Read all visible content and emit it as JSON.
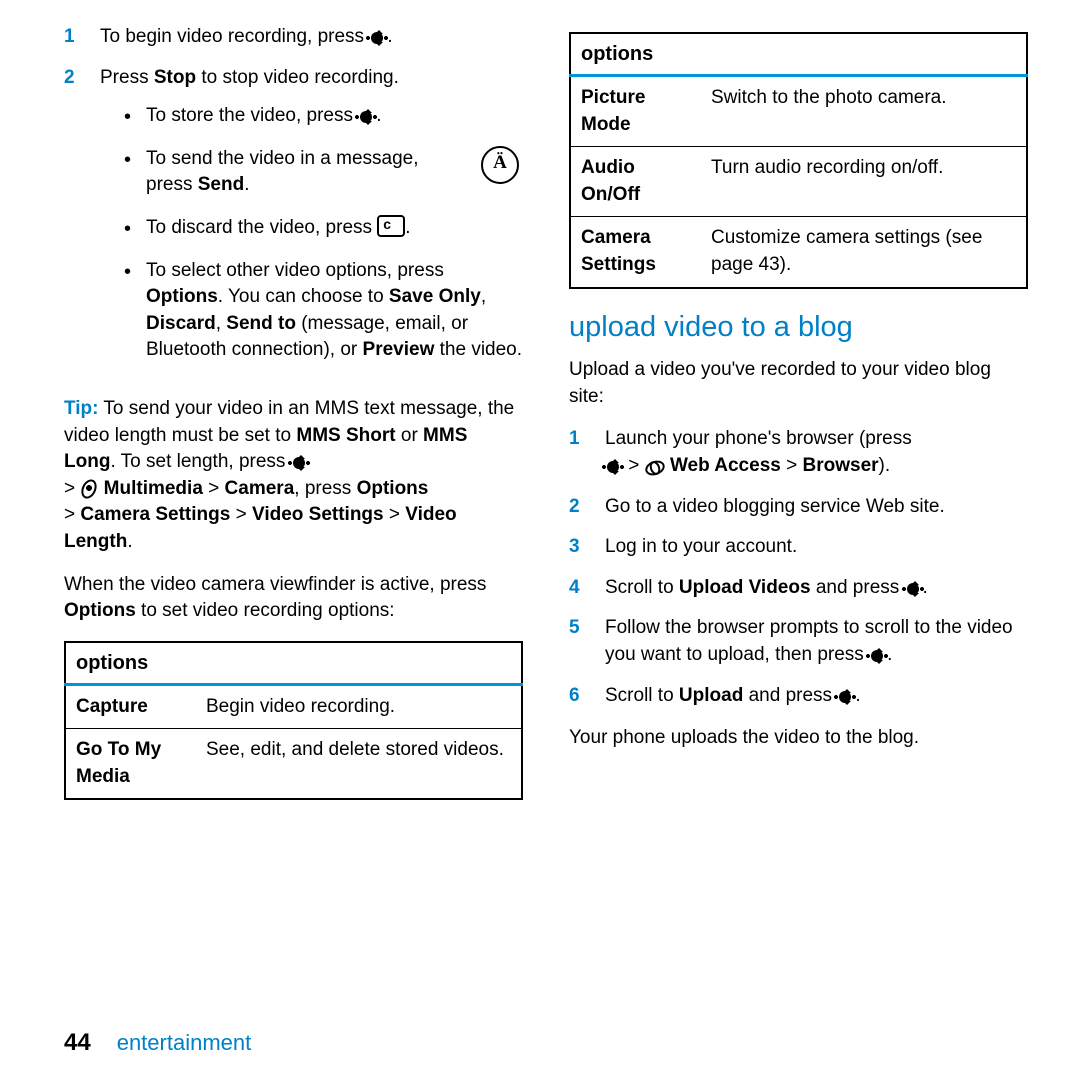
{
  "left": {
    "steps": [
      {
        "n": "1",
        "pre": "To begin video recording, press ",
        "post": "."
      },
      {
        "n": "2",
        "pre": "Press ",
        "b1": "Stop",
        "post": " to stop video recording.",
        "subs": [
          {
            "pre": "To store the video, press ",
            "icon": "center",
            "post": "."
          },
          {
            "pre": "To send the video in a message, press ",
            "b": "Send",
            "post": ".",
            "float": "antenna"
          },
          {
            "pre": "To discard the video, press ",
            "icon": "clear",
            "post": "."
          },
          {
            "pre": "To select other video options, press ",
            "b": "Options",
            "post2": ". You can choose to ",
            "b2": "Save Only",
            "c1": ", ",
            "b3": "Discard",
            "c2": ", ",
            "b4": "Send to",
            "post3": " (message, email, or Bluetooth connection), or ",
            "b5": "Preview",
            "post4": " the video."
          }
        ]
      }
    ],
    "tip": {
      "label": "Tip:",
      "t1": " To send your video in an MMS text message, the video length must be set to ",
      "b1": "MMS Short",
      "t2": " or ",
      "b2": "MMS Long",
      "t3": ". To set length, press ",
      "line2a": " > ",
      "b3": "Multimedia",
      "t4": " > ",
      "b4": "Camera",
      "t5": ", press ",
      "b5": "Options",
      "line3a": " > ",
      "b6": "Camera Settings",
      "t6": " > ",
      "b7": "Video Settings",
      "t7": " > ",
      "b8": "Video Length",
      "t8": "."
    },
    "p1a": "When the video camera viewfinder is active, press ",
    "p1b": "Options",
    "p1c": " to set video recording options:",
    "tableHeader": "options",
    "rows": [
      {
        "k": "Capture",
        "v": "Begin video recording."
      },
      {
        "k": "Go To My Media",
        "v": "See, edit, and delete stored videos."
      }
    ]
  },
  "right": {
    "tableHeader": "options",
    "rows": [
      {
        "k": "Picture Mode",
        "v": "Switch to the photo camera."
      },
      {
        "k": "Audio On/Off",
        "v": "Turn audio recording on/off."
      },
      {
        "k": "Camera Settings",
        "v": "Customize camera settings (see page 43)."
      }
    ],
    "heading": "upload video to a blog",
    "intro": "Upload a video you've recorded to your video blog site:",
    "steps": [
      {
        "n": "1",
        "t": "Launch your phone's browser (press",
        "line2": " > ",
        "b1": "Web Access",
        "t2": " > ",
        "b2": "Browser",
        "t3": ")."
      },
      {
        "n": "2",
        "t": "Go to a video blogging service Web site."
      },
      {
        "n": "3",
        "t": "Log in to your account."
      },
      {
        "n": "4",
        "t1": "Scroll to ",
        "b": "Upload Videos",
        "t2": " and press ",
        "post": "."
      },
      {
        "n": "5",
        "t1": "Follow the browser prompts to scroll to the video you want to upload, then press ",
        "post": "."
      },
      {
        "n": "6",
        "t1": "Scroll to ",
        "b": "Upload",
        "t2": " and press ",
        "post": "."
      }
    ],
    "outro": "Your phone uploads the video to the blog."
  },
  "footer": {
    "page": "44",
    "section": "entertainment"
  }
}
